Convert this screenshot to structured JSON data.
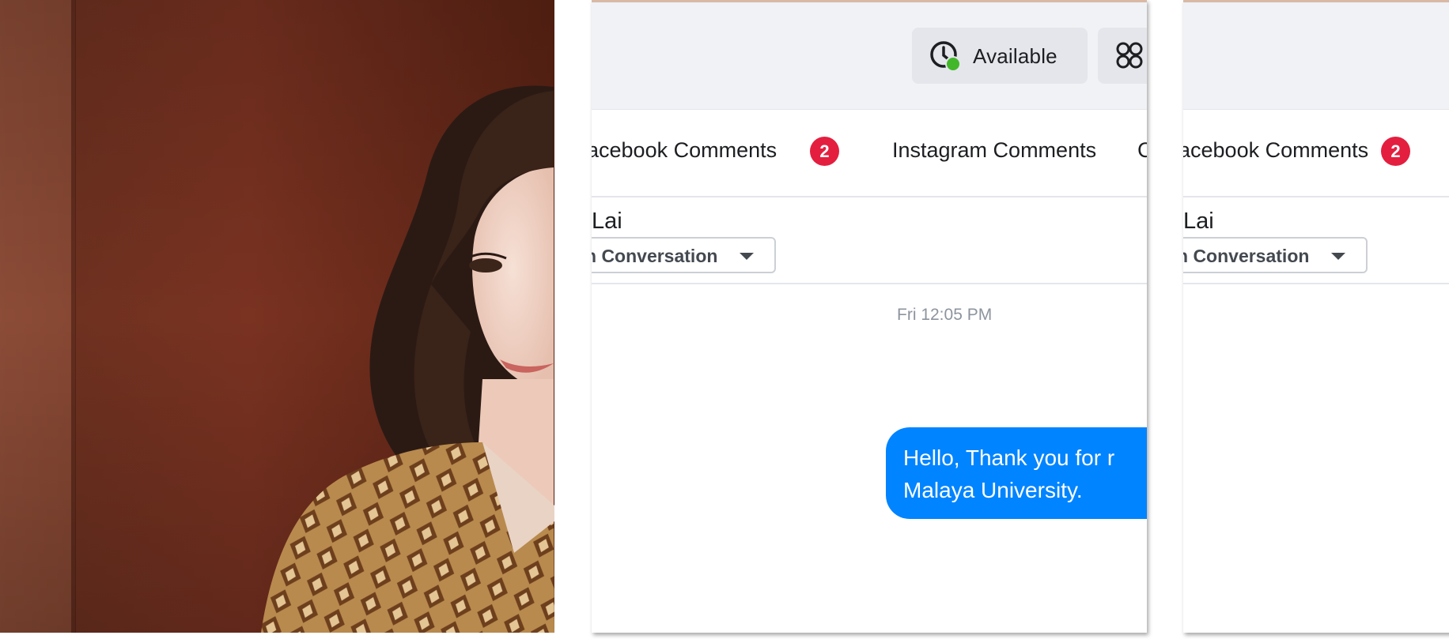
{
  "status": {
    "label": "Available",
    "indicator_color": "#42b72a"
  },
  "tabs": [
    {
      "label": "acebook Comments",
      "badge": "2"
    },
    {
      "label": "Instagram Comments"
    },
    {
      "label": "C"
    }
  ],
  "conversation": {
    "contact_name": "Lai",
    "status_value": "n Conversation"
  },
  "messages": [
    {
      "timestamp": "Fri 12:05 PM",
      "text": "Hello, Thank you for r\nMalaya University."
    }
  ],
  "colors": {
    "accent": "#0084ff",
    "badge": "#e41e3f",
    "header_bg": "#f0f2f5"
  }
}
